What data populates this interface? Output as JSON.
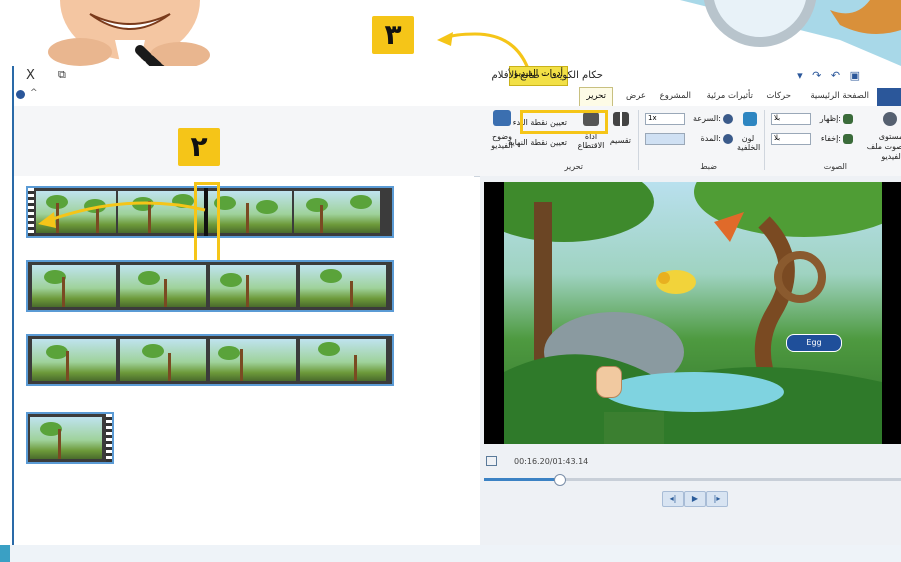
{
  "callouts": {
    "step2": "٢",
    "step3": "٣"
  },
  "window": {
    "title": "حكام الكويت - صانع الأفلام",
    "context_tab": "أدوات الفيديو",
    "controls": {
      "close": "X",
      "restore": "⧉"
    }
  },
  "tabs": {
    "file": "",
    "home": "الصفحة الرئيسية",
    "animations": "حركات",
    "visual_effects": "تأثيرات مرئية",
    "project": "المشروع",
    "view": "عرض",
    "edit": "تحرير"
  },
  "ribbon": {
    "audio": {
      "group": "الصوت",
      "volume_label": "مستوى صوت ملف الفيديو",
      "fade_in_label": "إظهار:",
      "fade_in_value": "بلا",
      "fade_out_label": "إخفاء:",
      "fade_out_value": "بلا"
    },
    "adjust": {
      "group": "ضبط",
      "bg_color_label": "لون الخلفية",
      "speed_label": "السرعة:",
      "speed_value": "1x",
      "duration_label": "المدة:",
      "duration_value": ""
    },
    "editing": {
      "group": "تحرير",
      "split_label": "تقسيم",
      "trim_label": "أداة الاقتطاع",
      "set_start_label": "تعيين نقطة البدء",
      "set_end_label": "تعيين نقطة النهاية",
      "stabilization_label": "وضوح الفيديو"
    }
  },
  "preview": {
    "time": "00:16.20/01:43.14",
    "caption": "Egg",
    "controls": {
      "prev": "◂|",
      "play": "▶",
      "next": "|▸"
    }
  },
  "colors": {
    "accent_yellow": "#f5c518",
    "ribbon_blue": "#2b579a",
    "strip_border": "#5b9bd5"
  }
}
